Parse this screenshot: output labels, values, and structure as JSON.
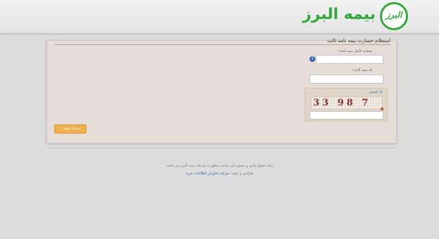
{
  "header": {
    "logo_text": "بیمه البرز",
    "logo_mark": "البرز"
  },
  "panel": {
    "title": "استعلام خسارت بیمه نامه ثالث",
    "fields": {
      "policy_number": {
        "label": "شماره کامل بیمه نامه",
        "value": ""
      },
      "insurer_code": {
        "label": "کد بیمه گذار",
        "value": ""
      },
      "captcha": {
        "label": "کد امنیتی",
        "image_text": "33 98 7",
        "value": ""
      }
    },
    "next_button": "مرحله بعدی »"
  },
  "footer": {
    "copyright": "تمام حقوق مادی و معنوی این سایت متعلق به شرکت بیمه البرز می باشد.",
    "credit_prefix": "طراحی و تولید:",
    "credit_link": "شرکت فناوران اطلاعات خبره"
  },
  "colors": {
    "brand_green": "#35a83b",
    "button_orange": "#efb14f",
    "panel_bg": "#e6ddd8",
    "link_blue": "#2b5fa8"
  },
  "icons": {
    "info": "info-icon",
    "logo": "alborz-logo-icon"
  }
}
